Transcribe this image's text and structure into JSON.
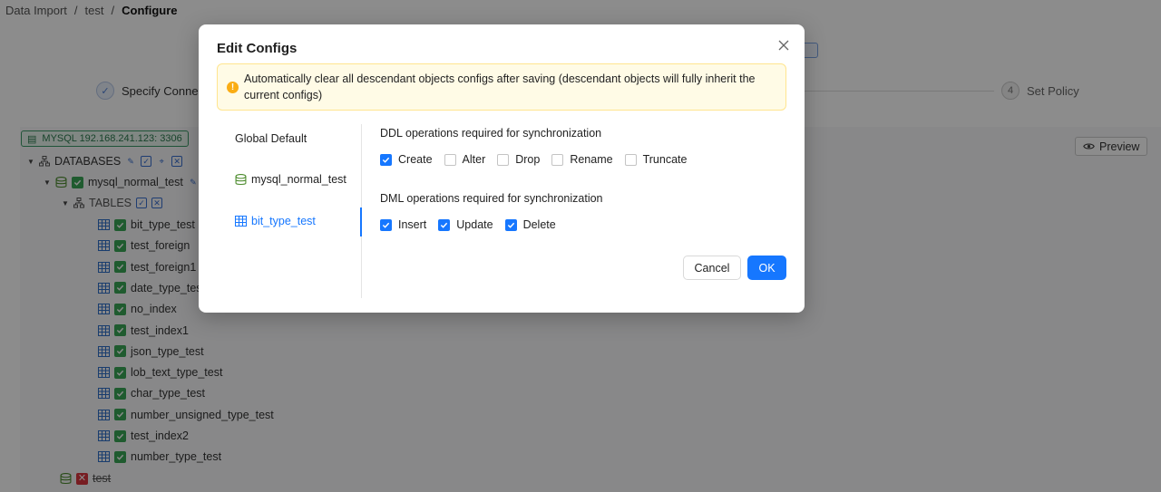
{
  "breadcrumb": {
    "item1": "Data Import",
    "sep1": "/",
    "item2": "test",
    "sep2": "/",
    "current": "Configure"
  },
  "steps": {
    "step1": {
      "label": "Specify Connect"
    },
    "step4": {
      "num": "4",
      "label": "Set Policy"
    }
  },
  "connection": {
    "label": "MYSQL  192.168.241.123: 3306"
  },
  "preview": {
    "label": "Preview"
  },
  "tree": {
    "databases_label": "DATABASES",
    "db1": "mysql_normal_test",
    "tables_label": "TABLES",
    "tables": [
      "bit_type_test",
      "test_foreign",
      "test_foreign1",
      "date_type_tes",
      "no_index",
      "test_index1",
      "json_type_test",
      "lob_text_type_test",
      "char_type_test",
      "number_unsigned_type_test",
      "test_index2",
      "number_type_test"
    ],
    "db2": "test"
  },
  "modal": {
    "title": "Edit Configs",
    "alert": "Automatically clear all descendant objects configs after saving (descendant objects will fully inherit the current configs)",
    "sidebar": {
      "global": "Global Default",
      "database": "mysql_normal_test",
      "table": "bit_type_test"
    },
    "ddl": {
      "title": "DDL operations required for synchronization",
      "options": [
        {
          "label": "Create",
          "checked": true
        },
        {
          "label": "Alter",
          "checked": false
        },
        {
          "label": "Drop",
          "checked": false
        },
        {
          "label": "Rename",
          "checked": false
        },
        {
          "label": "Truncate",
          "checked": false
        }
      ]
    },
    "dml": {
      "title": "DML operations required for synchronization",
      "options": [
        {
          "label": "Insert",
          "checked": true
        },
        {
          "label": "Update",
          "checked": true
        },
        {
          "label": "Delete",
          "checked": true
        }
      ]
    },
    "cancel": "Cancel",
    "ok": "OK"
  },
  "colors": {
    "primary": "#1677ff",
    "alert_bg": "#fffbe6",
    "alert_border": "#ffe58f",
    "warn": "#faad14",
    "success": "#3aa757",
    "danger": "#d9363e"
  }
}
